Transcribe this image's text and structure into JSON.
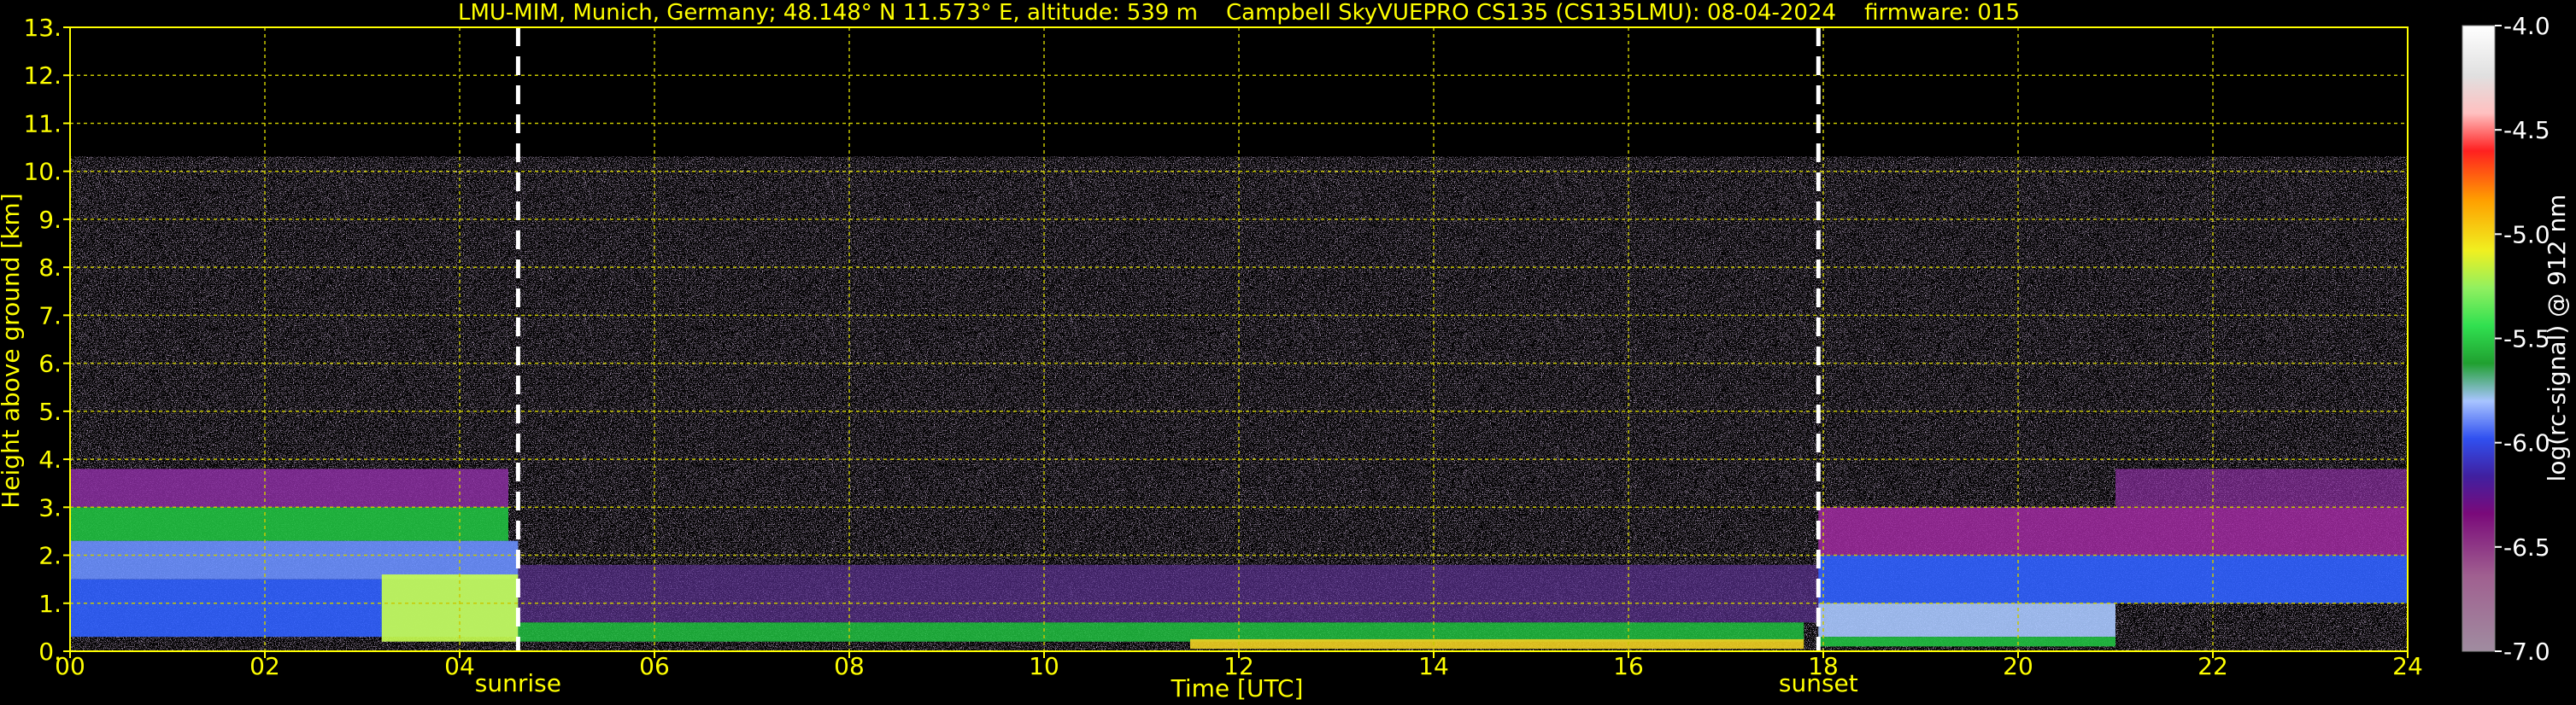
{
  "chart_data": {
    "type": "heatmap",
    "title": "LMU-MIM, Munich, Germany; 48.148° N 11.573° E, altitude: 539 m    Campbell SkyVUEPRO CS135 (CS135LMU): 08-04-2024    firmware: 015",
    "xlabel": "Time [UTC]",
    "ylabel": "Height above ground [km]",
    "xlim": [
      0,
      24
    ],
    "ylim": [
      0,
      13
    ],
    "x_ticks": [
      "00",
      "02",
      "04",
      "06",
      "08",
      "10",
      "12",
      "14",
      "16",
      "18",
      "20",
      "22",
      "24"
    ],
    "y_ticks": [
      "0.",
      "1.",
      "2.",
      "3.",
      "4.",
      "5.",
      "6.",
      "7.",
      "8.",
      "9.",
      "10.",
      "11.",
      "12.",
      "13."
    ],
    "grid": true,
    "signal_top_km": 10.3,
    "annotations": [
      {
        "label": "sunrise",
        "x": 4.6
      },
      {
        "label": "sunset",
        "x": 17.95
      }
    ],
    "colorbar": {
      "label": "log(rc-signal) @ 912 nm",
      "min": -7.0,
      "max": -4.0,
      "ticks": [
        "-4.0",
        "-4.5",
        "-5.0",
        "-5.5",
        "-6.0",
        "-6.5",
        "-7.0"
      ]
    }
  },
  "colors": {
    "text": "#ffff00",
    "grid": "#c8c800",
    "background": "#000000",
    "colorbar_label": "#ffffff"
  }
}
